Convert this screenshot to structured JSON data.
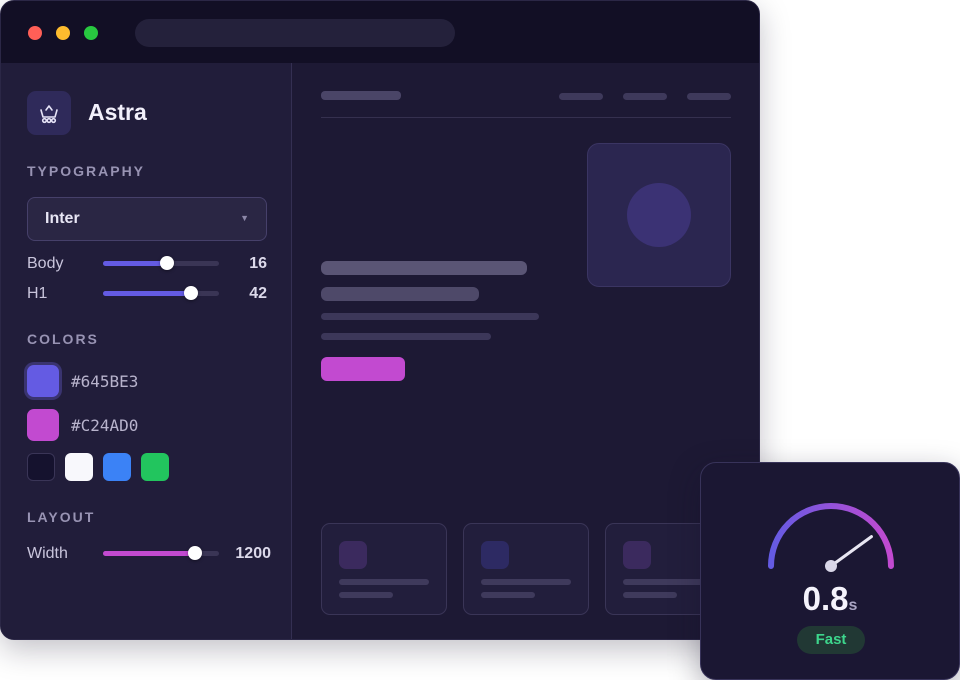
{
  "app": {
    "name": "Astra"
  },
  "colors": {
    "accent": "#645BE3",
    "secondary": "#C24AD0",
    "traffic_red": "#ff5f57",
    "traffic_yellow": "#febc2e",
    "traffic_green": "#28c840"
  },
  "sidebar": {
    "brand_icon": "robot-cart-icon",
    "typography": {
      "label": "TYPOGRAPHY",
      "font_select": {
        "value": "Inter"
      },
      "sliders": [
        {
          "label": "Body",
          "value": "16",
          "fraction": 0.55
        },
        {
          "label": "H1",
          "value": "42",
          "fraction": 0.76
        }
      ]
    },
    "colors": {
      "label": "COLORS",
      "primary": {
        "hex": "#645BE3"
      },
      "secondary": {
        "hex": "#C24AD0"
      },
      "presets": [
        "#15122e",
        "#f8f8fc",
        "#3b82f6",
        "#22c55e"
      ]
    },
    "layout": {
      "label": "LAYOUT",
      "width": {
        "label": "Width",
        "value": "1200",
        "fraction": 0.79
      }
    }
  },
  "performance": {
    "value": "0.8",
    "unit": "s",
    "status": "Fast",
    "gauge_fraction": 0.8,
    "status_color": "#3dd68c"
  }
}
